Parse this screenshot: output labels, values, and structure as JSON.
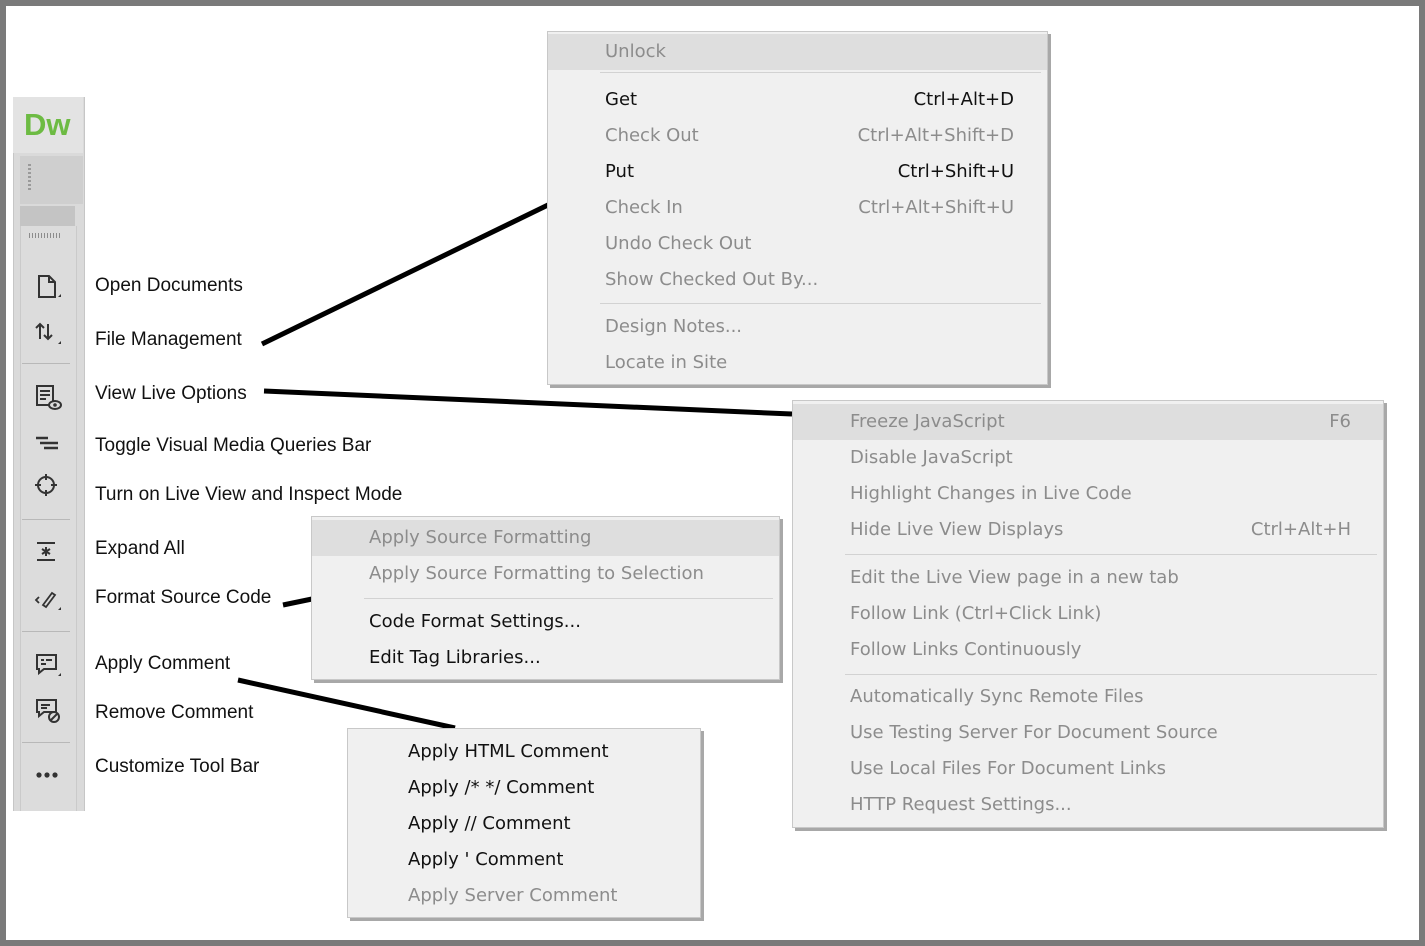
{
  "app": {
    "logo": "Dw"
  },
  "toolbar_labels": {
    "open_documents": "Open Documents",
    "file_management": "File Management",
    "view_live_options": "View Live Options",
    "toggle_media_queries": "Toggle Visual Media Queries Bar",
    "live_inspect": "Turn on Live View and Inspect Mode",
    "expand_all": "Expand All",
    "format_source": "Format Source Code",
    "apply_comment": "Apply Comment",
    "remove_comment": "Remove Comment",
    "customize_toolbar": "Customize Tool Bar"
  },
  "icons": [
    "document-icon",
    "transfer-arrows-icon",
    "live-view-options-icon",
    "media-queries-icon",
    "crosshair-icon",
    "expand-all-icon",
    "format-source-icon",
    "comment-icon",
    "remove-comment-icon",
    "more-icon"
  ],
  "file_menu": {
    "items": [
      {
        "label": "Unlock",
        "shortcut": ""
      },
      {
        "label": "Get",
        "shortcut": "Ctrl+Alt+D"
      },
      {
        "label": "Check Out",
        "shortcut": "Ctrl+Alt+Shift+D"
      },
      {
        "label": "Put",
        "shortcut": "Ctrl+Shift+U"
      },
      {
        "label": "Check In",
        "shortcut": "Ctrl+Alt+Shift+U"
      },
      {
        "label": "Undo Check Out",
        "shortcut": ""
      },
      {
        "label": "Show Checked Out By...",
        "shortcut": ""
      },
      {
        "label": "Design Notes...",
        "shortcut": ""
      },
      {
        "label": "Locate in Site",
        "shortcut": ""
      }
    ]
  },
  "live_menu": {
    "items": [
      {
        "label": "Freeze JavaScript",
        "shortcut": "F6"
      },
      {
        "label": "Disable JavaScript",
        "shortcut": ""
      },
      {
        "label": "Highlight Changes in Live Code",
        "shortcut": ""
      },
      {
        "label": "Hide Live View Displays",
        "shortcut": "Ctrl+Alt+H"
      },
      {
        "label": "Edit the Live View page in a new tab",
        "shortcut": ""
      },
      {
        "label": "Follow Link (Ctrl+Click Link)",
        "shortcut": ""
      },
      {
        "label": "Follow Links Continuously",
        "shortcut": ""
      },
      {
        "label": "Automatically Sync Remote Files",
        "shortcut": ""
      },
      {
        "label": "Use Testing Server For Document Source",
        "shortcut": ""
      },
      {
        "label": "Use Local Files For Document Links",
        "shortcut": ""
      },
      {
        "label": "HTTP Request Settings...",
        "shortcut": ""
      }
    ]
  },
  "format_menu": {
    "items": [
      {
        "label": "Apply Source Formatting"
      },
      {
        "label": "Apply Source Formatting to Selection"
      },
      {
        "label": "Code Format Settings..."
      },
      {
        "label": "Edit Tag Libraries..."
      }
    ]
  },
  "comment_menu": {
    "items": [
      {
        "label": "Apply HTML Comment"
      },
      {
        "label": "Apply /* */ Comment"
      },
      {
        "label": "Apply // Comment"
      },
      {
        "label": "Apply ' Comment"
      },
      {
        "label": "Apply Server Comment"
      }
    ]
  },
  "colors": {
    "logo_green": "#6dbb43",
    "menu_bg": "#f0f0f0",
    "disabled_text": "#8c8c8c"
  }
}
